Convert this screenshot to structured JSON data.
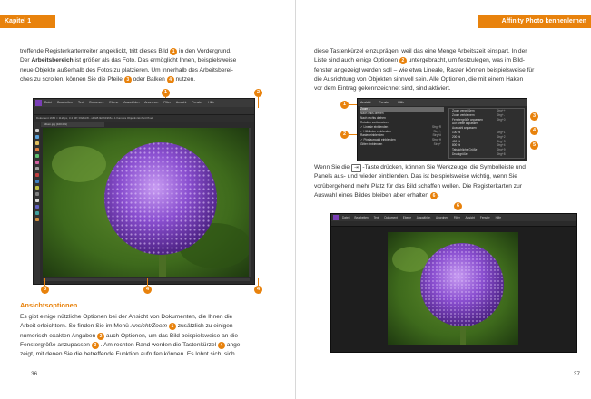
{
  "left_page": {
    "chapter": "Kapitel 1",
    "para1": [
      "treffende Registerkartenreiter angeklickt, tritt dieses Bild",
      "in den Vordergrund.",
      "Arbeitsbereich",
      "ist größer als das Foto. Das ermöglicht Ihnen, beispielsweise",
      "neue Objekte außerhalb des Fotos zu platzieren. Um innerhalb des Arbeitsberei-",
      "ches zu scrollen, können Sie die Pfeile",
      "oder Balken",
      "nutzen."
    ],
    "para1_lead": "Der",
    "screenshot_menu": [
      "Datei",
      "Bearbeiten",
      "Text",
      "Dokument",
      "Ebene",
      "Auswählen",
      "Anordnen",
      "Filter",
      "Ansicht",
      "Fenster",
      "Hilfe"
    ],
    "screenshot_context": "Dokument  1680 × 1120px, 3.4 MP, RGBA/8 - sRGB IEC61966-2.1   Kamera   Objektiv   Einheit   Pixel",
    "screenshot_tab": "Allium.jpg (100.0%)",
    "section_heading": "Ansichtsoptionen",
    "para2": [
      "Es gibt einige nützliche Optionen bei der Ansicht von Dokumenten, die Ihnen die",
      "Arbeit erleichtern. So finden Sie im Menü",
      "Ansicht/Zoom",
      "zusätzlich zu einigen",
      "numerisch exakten Angaben",
      "auch Optionen, um das Bild beispielsweise an die",
      "Fenstergröße anzupassen",
      ". Am rechten Rand werden die Tastenkürzel",
      "ange-",
      "zeigt, mit denen Sie die betreffende Funktion aufrufen können. Es lohnt sich, sich"
    ],
    "page_number": "36"
  },
  "right_page": {
    "chapter": "Affinity Photo kennenlernen",
    "para1": [
      "diese Tastenkürzel einzuprägen, weil das eine Menge Arbeitszeit einspart. In der",
      "Liste sind auch einige Optionen",
      "untergebracht, um festzulegen, was im Bild-",
      "fenster angezeigt werden soll – wie etwa Lineale, Raster können beispielsweise für",
      "die Ausrichtung von Objekten sinnvoll sein. Alle Optionen, die mit einem Haken",
      "vor dem Eintrag gekennzeichnet sind, sind aktiviert."
    ],
    "menu_bar": [
      "Ansicht",
      "Fenster",
      "Hilfe"
    ],
    "menu_items": [
      {
        "label": "Zoom",
        "shortcut": ""
      },
      {
        "label": "Nach links drehen",
        "shortcut": ""
      },
      {
        "label": "Nach rechts drehen",
        "shortcut": ""
      },
      {
        "label": "Rotation zurücksetzen",
        "shortcut": ""
      },
      {
        "label": "✓ Lineale einblenden",
        "shortcut": "Strg+R"
      },
      {
        "label": "✓ Hilfslinien einblenden",
        "shortcut": "Strg+,"
      },
      {
        "label": "Raster einblenden",
        "shortcut": "Strg+#"
      },
      {
        "label": "✓ Pixelauswahl einblenden",
        "shortcut": "Strg+H"
      },
      {
        "label": "Gitter einblenden",
        "shortcut": "Strg+'"
      }
    ],
    "submenu_items": [
      {
        "label": "Zoom vergrößern",
        "shortcut": "Strg++"
      },
      {
        "label": "Zoom verkleinern",
        "shortcut": "Strg+-"
      },
      {
        "label": "Fenstergröße anpassen",
        "shortcut": "Strg+0"
      },
      {
        "label": "Auf Breite anpassen",
        "shortcut": ""
      },
      {
        "label": "Auswahl anpassen",
        "shortcut": ""
      },
      {
        "label": "100 %",
        "shortcut": "Strg+1"
      },
      {
        "label": "200 %",
        "shortcut": "Strg+2"
      },
      {
        "label": "400 %",
        "shortcut": "Strg+3"
      },
      {
        "label": "800 %",
        "shortcut": "Strg+4"
      },
      {
        "label": "Tatsächliche Größe",
        "shortcut": "Strg+9"
      },
      {
        "label": "Druckgröße",
        "shortcut": "Strg+8"
      }
    ],
    "para2": [
      "Wenn Sie die",
      "-Taste drücken, können Sie Werkzeuge, die Symbolleiste und",
      "Panels aus- und wieder einblenden. Das ist beispielsweise wichtig, wenn Sie",
      "vorübergehend mehr Platz für das Bild schaffen wollen. Die Registerkarten zur",
      "Auswahl eines Bildes bleiben aber erhalten"
    ],
    "tab_key": "⇥",
    "screenshot_menu": [
      "Datei",
      "Bearbeiten",
      "Text",
      "Dokument",
      "Ebene",
      "Auswählen",
      "Anordnen",
      "Filter",
      "Ansicht",
      "Fenster",
      "Hilfe"
    ],
    "page_number": "37"
  },
  "callouts": [
    "1",
    "2",
    "3",
    "4",
    "5",
    "6"
  ],
  "colors": {
    "accent": "#e8820c",
    "app_dark": "#2b2b2b",
    "flower": "#8a4fd0"
  }
}
